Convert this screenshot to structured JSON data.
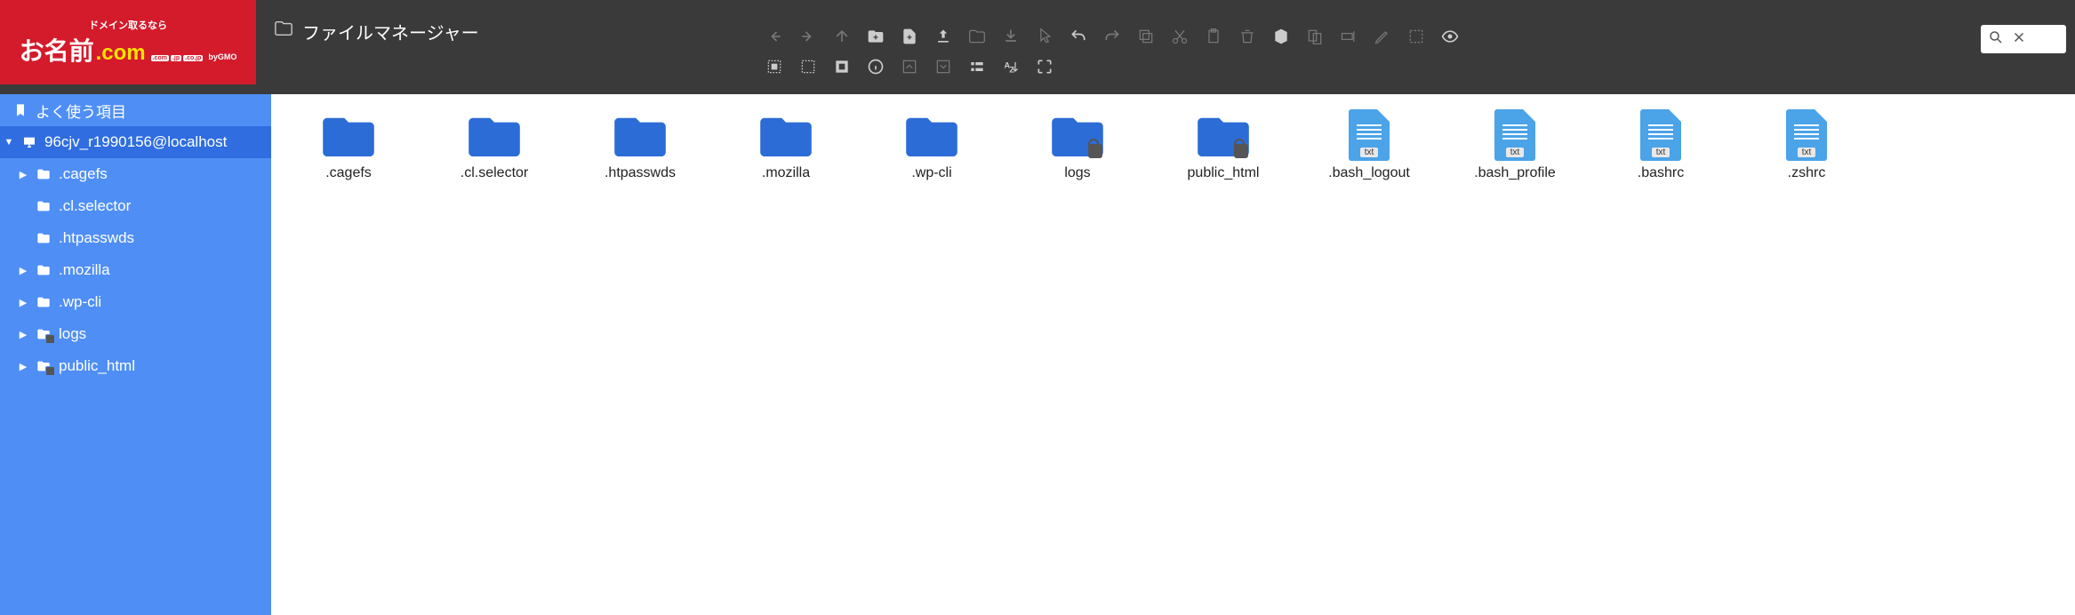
{
  "logo": {
    "tagline": "ドメイン取るなら",
    "kanji": "お名前",
    "com": ".com",
    "badges": [
      ".com",
      ".jp",
      ".co.jp"
    ],
    "by": "byGMO"
  },
  "title": "ファイルマネージャー",
  "sidebar": {
    "favorites": "よく使う項目",
    "host": "96cjv_r1990156@localhost",
    "folders": [
      {
        "name": ".cagefs",
        "expandable": true,
        "locked": false
      },
      {
        "name": ".cl.selector",
        "expandable": false,
        "locked": false
      },
      {
        "name": ".htpasswds",
        "expandable": false,
        "locked": false
      },
      {
        "name": ".mozilla",
        "expandable": true,
        "locked": false
      },
      {
        "name": ".wp-cli",
        "expandable": true,
        "locked": false
      },
      {
        "name": "logs",
        "expandable": true,
        "locked": true
      },
      {
        "name": "public_html",
        "expandable": true,
        "locked": true
      }
    ]
  },
  "items": [
    {
      "name": ".cagefs",
      "type": "folder",
      "locked": false
    },
    {
      "name": ".cl.selector",
      "type": "folder",
      "locked": false
    },
    {
      "name": ".htpasswds",
      "type": "folder",
      "locked": false
    },
    {
      "name": ".mozilla",
      "type": "folder",
      "locked": false
    },
    {
      "name": ".wp-cli",
      "type": "folder",
      "locked": false
    },
    {
      "name": "logs",
      "type": "folder",
      "locked": true
    },
    {
      "name": "public_html",
      "type": "folder",
      "locked": true
    },
    {
      "name": ".bash_logout",
      "type": "file",
      "ext": "txt"
    },
    {
      "name": ".bash_profile",
      "type": "file",
      "ext": "txt"
    },
    {
      "name": ".bashrc",
      "type": "file",
      "ext": "txt"
    },
    {
      "name": ".zshrc",
      "type": "file",
      "ext": "txt"
    }
  ]
}
